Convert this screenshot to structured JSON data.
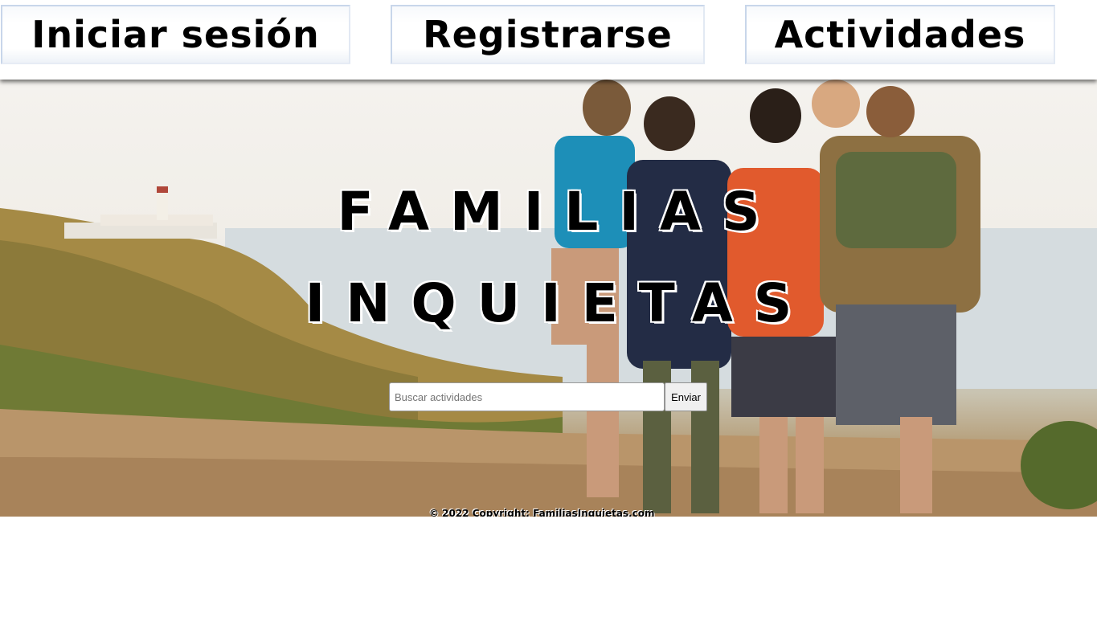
{
  "nav": {
    "login_label": "Iniciar sesión",
    "register_label": "Registrarse",
    "activities_label": "Actividades"
  },
  "hero": {
    "title_line_1": "FAMILIAS",
    "title_line_2": "INQUIETAS",
    "image_alt": "family-hiking-photo"
  },
  "search": {
    "placeholder": "Buscar actividades",
    "value": "",
    "submit_label": "Enviar"
  },
  "footer": {
    "copyright": "© 2022 Copyright: FamiliasInquietas.com"
  },
  "colors": {
    "nav_background": "#ffffff",
    "nav_button_border": "#c8d6ea",
    "title_text": "#000000",
    "title_outline": "#ffffff"
  }
}
